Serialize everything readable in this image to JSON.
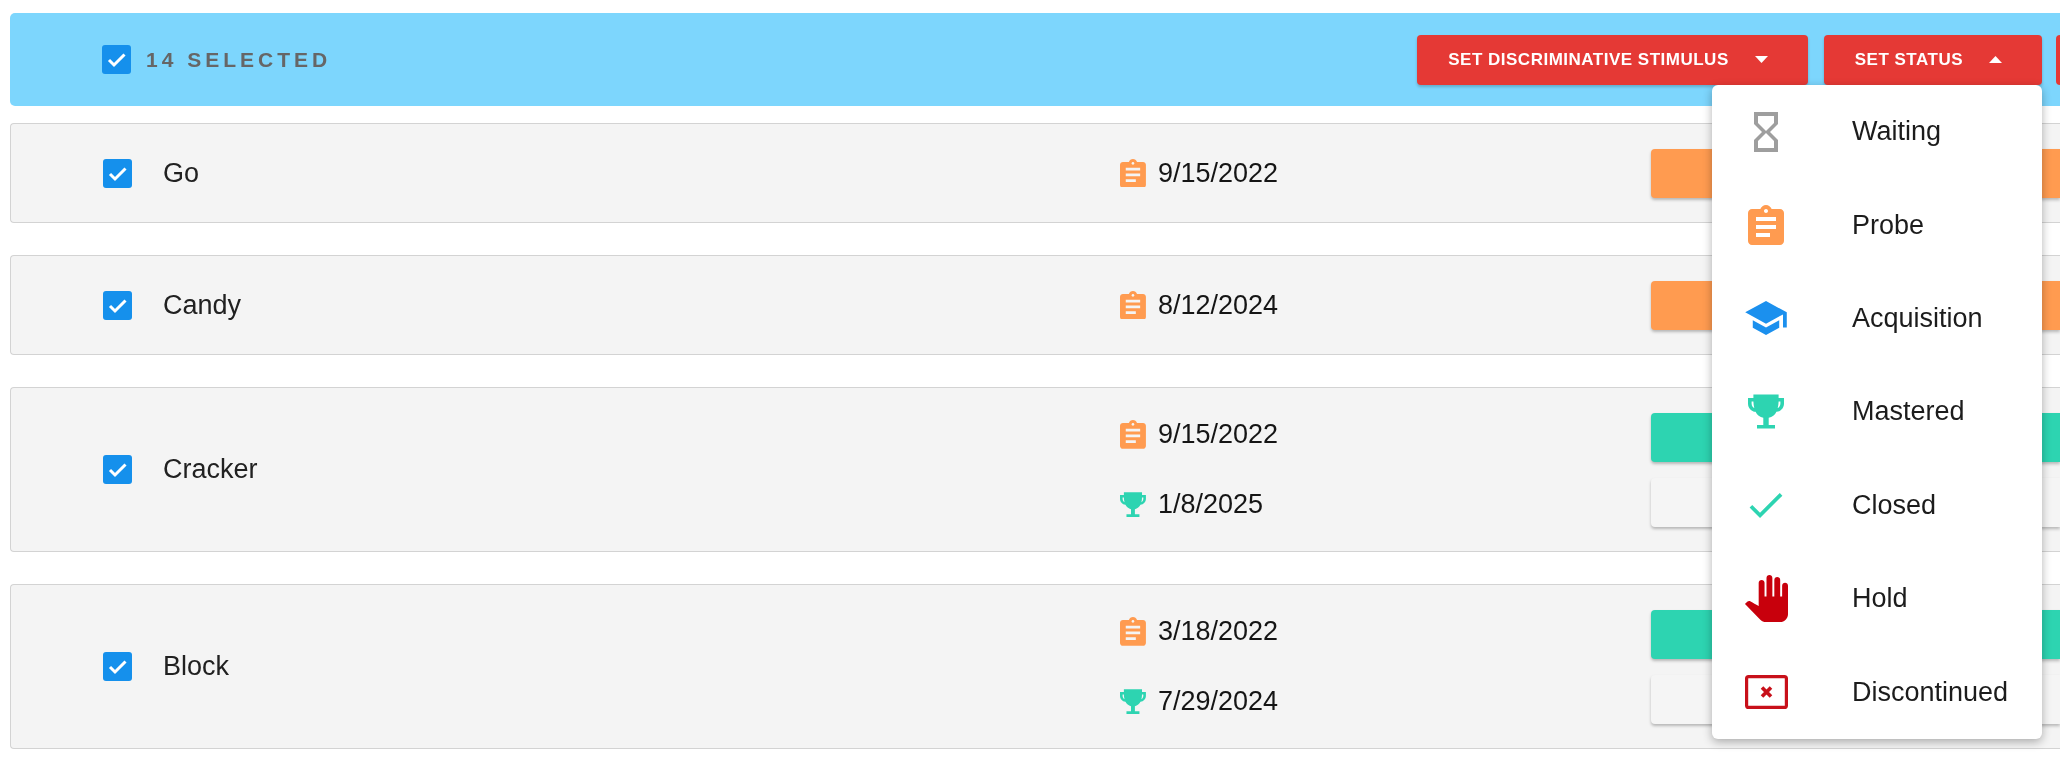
{
  "header": {
    "checked": true,
    "selection_label": "14 SELECTED",
    "actions": [
      {
        "label": "SET DISCRIMINATIVE STIMULUS",
        "expanded": false
      },
      {
        "label": "SET STATUS",
        "expanded": true
      }
    ]
  },
  "rows": [
    {
      "name": "Go",
      "checked": true,
      "dates": [
        {
          "kind": "probe",
          "text": "9/15/2022"
        }
      ],
      "status_buttons": [
        {
          "color": "#ff9b50"
        }
      ]
    },
    {
      "name": "Candy",
      "checked": true,
      "dates": [
        {
          "kind": "probe",
          "text": "8/12/2024"
        }
      ],
      "status_buttons": [
        {
          "color": "#ff9b50"
        }
      ]
    },
    {
      "name": "Cracker",
      "checked": true,
      "dates": [
        {
          "kind": "probe",
          "text": "9/15/2022"
        },
        {
          "kind": "mastered",
          "text": "1/8/2025"
        }
      ],
      "status_buttons": [
        {
          "color": "#2dd4b1"
        },
        {
          "color": "#f5f5f5"
        }
      ]
    },
    {
      "name": "Block",
      "checked": true,
      "dates": [
        {
          "kind": "probe",
          "text": "3/18/2022"
        },
        {
          "kind": "mastered",
          "text": "7/29/2024"
        }
      ],
      "status_buttons": [
        {
          "color": "#2dd4b1"
        },
        {
          "color": "#f5f5f5"
        }
      ]
    }
  ],
  "status_menu": {
    "items": [
      {
        "kind": "waiting",
        "label": "Waiting"
      },
      {
        "kind": "probe",
        "label": "Probe"
      },
      {
        "kind": "acquisition",
        "label": "Acquisition"
      },
      {
        "kind": "mastered",
        "label": "Mastered"
      },
      {
        "kind": "closed",
        "label": "Closed"
      },
      {
        "kind": "hold",
        "label": "Hold"
      },
      {
        "kind": "discontinued",
        "label": "Discontinued"
      }
    ]
  }
}
